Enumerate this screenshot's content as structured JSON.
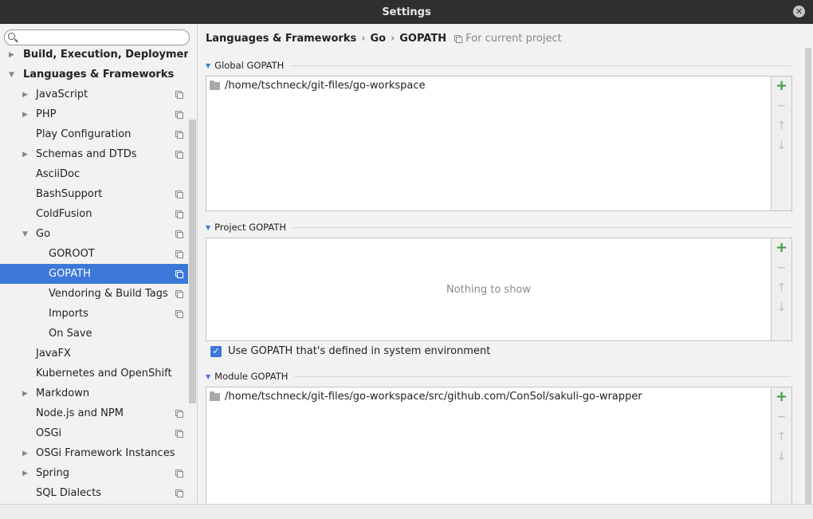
{
  "window": {
    "title": "Settings"
  },
  "search": {
    "placeholder": ""
  },
  "tree": {
    "items": [
      {
        "label": "Build, Execution, Deployment",
        "level": 0,
        "arrow": "right",
        "bold": true,
        "copy": false
      },
      {
        "label": "Languages & Frameworks",
        "level": 0,
        "arrow": "down",
        "bold": true,
        "copy": false
      },
      {
        "label": "JavaScript",
        "level": 1,
        "arrow": "right",
        "copy": true
      },
      {
        "label": "PHP",
        "level": 1,
        "arrow": "right",
        "copy": true
      },
      {
        "label": "Play Configuration",
        "level": 1,
        "arrow": "",
        "copy": true
      },
      {
        "label": "Schemas and DTDs",
        "level": 1,
        "arrow": "right",
        "copy": true
      },
      {
        "label": "AsciiDoc",
        "level": 1,
        "arrow": "",
        "copy": false
      },
      {
        "label": "BashSupport",
        "level": 1,
        "arrow": "",
        "copy": true
      },
      {
        "label": "ColdFusion",
        "level": 1,
        "arrow": "",
        "copy": true
      },
      {
        "label": "Go",
        "level": 1,
        "arrow": "down",
        "copy": true
      },
      {
        "label": "GOROOT",
        "level": 2,
        "arrow": "",
        "copy": true
      },
      {
        "label": "GOPATH",
        "level": 2,
        "arrow": "",
        "copy": true,
        "selected": true
      },
      {
        "label": "Vendoring & Build Tags",
        "level": 2,
        "arrow": "",
        "copy": true
      },
      {
        "label": "Imports",
        "level": 2,
        "arrow": "",
        "copy": true
      },
      {
        "label": "On Save",
        "level": 2,
        "arrow": "",
        "copy": false
      },
      {
        "label": "JavaFX",
        "level": 1,
        "arrow": "",
        "copy": false
      },
      {
        "label": "Kubernetes and OpenShift",
        "level": 1,
        "arrow": "",
        "copy": false
      },
      {
        "label": "Markdown",
        "level": 1,
        "arrow": "right",
        "copy": false
      },
      {
        "label": "Node.js and NPM",
        "level": 1,
        "arrow": "",
        "copy": true
      },
      {
        "label": "OSGi",
        "level": 1,
        "arrow": "",
        "copy": true
      },
      {
        "label": "OSGi Framework Instances",
        "level": 1,
        "arrow": "right",
        "copy": false
      },
      {
        "label": "Spring",
        "level": 1,
        "arrow": "right",
        "copy": true
      },
      {
        "label": "SQL Dialects",
        "level": 1,
        "arrow": "",
        "copy": true
      }
    ]
  },
  "breadcrumb": {
    "items": [
      "Languages & Frameworks",
      "Go",
      "GOPATH"
    ],
    "separator": "›",
    "scope": "For current project"
  },
  "global": {
    "title": "Global GOPATH",
    "paths": [
      "/home/tschneck/git-files/go-workspace"
    ]
  },
  "project": {
    "title": "Project GOPATH",
    "empty_text": "Nothing to show",
    "checkbox_label": "Use GOPATH that's defined in system environment",
    "checkbox_checked": true
  },
  "module": {
    "title": "Module GOPATH",
    "paths": [
      "/home/tschneck/git-files/go-workspace/src/github.com/ConSol/sakuli-go-wrapper"
    ]
  },
  "tools": {
    "add": "+",
    "remove": "−",
    "up": "↑",
    "down": "↓"
  },
  "colors": {
    "accent": "#3b78d8",
    "add_green": "#3c9e3c",
    "titlebar": "#2f2f2f"
  }
}
